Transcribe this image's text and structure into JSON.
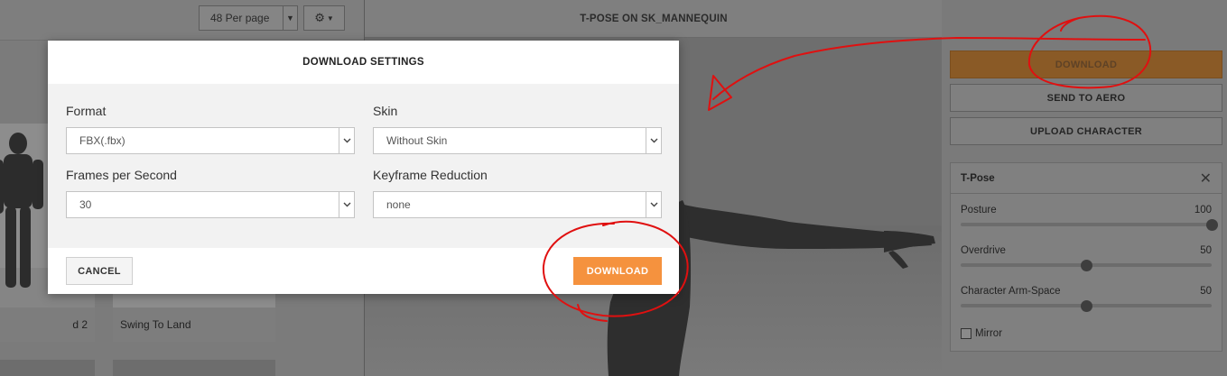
{
  "library": {
    "per_page_label": "48 Per page",
    "settings_icon": "gear-icon",
    "cards": [
      {
        "title": "d 2"
      },
      {
        "title": "Swing To Land"
      }
    ]
  },
  "viewer": {
    "title": "T-POSE ON SK_MANNEQUIN"
  },
  "right_panel": {
    "download_label": "DOWNLOAD",
    "send_to_aero_label": "SEND TO AERO",
    "upload_character_label": "UPLOAD CHARACTER",
    "animation": {
      "name": "T-Pose",
      "close_icon": "close-icon",
      "sliders": [
        {
          "label": "Posture",
          "value": 100,
          "max": 100
        },
        {
          "label": "Overdrive",
          "value": 50,
          "max": 100
        },
        {
          "label": "Character Arm-Space",
          "value": 50,
          "max": 100
        }
      ],
      "mirror_label": "Mirror",
      "mirror_checked": false
    }
  },
  "modal": {
    "title": "DOWNLOAD SETTINGS",
    "format": {
      "label": "Format",
      "value": "FBX(.fbx)"
    },
    "skin": {
      "label": "Skin",
      "value": "Without Skin"
    },
    "fps": {
      "label": "Frames per Second",
      "value": "30"
    },
    "keyframe_reduction": {
      "label": "Keyframe Reduction",
      "value": "none"
    },
    "cancel_label": "CANCEL",
    "download_label": "DOWNLOAD"
  },
  "colors": {
    "accent_orange": "#f5923e",
    "annotation_red": "#e01010"
  }
}
